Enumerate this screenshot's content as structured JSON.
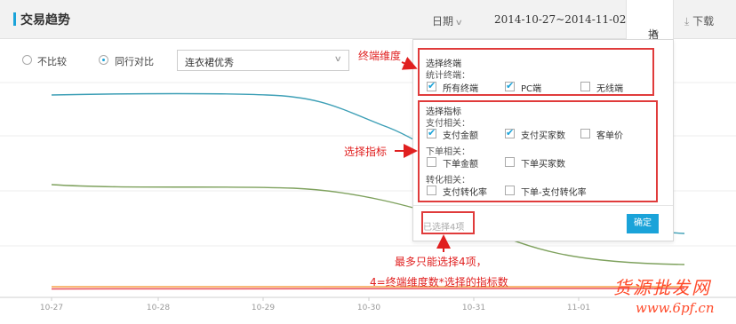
{
  "header": {
    "title": "交易趋势",
    "date_label": "日期",
    "date_range": "2014-10-27~2014-11-02",
    "indicator_label": "指标",
    "download_label": "下载"
  },
  "compare": {
    "no_compare": "不比较",
    "peer_compare": "同行对比",
    "select_value": "连衣裙优秀"
  },
  "chart_data": {
    "type": "line",
    "categories": [
      "10-27",
      "10-28",
      "10-29",
      "10-30",
      "10-31",
      "11-01"
    ],
    "series": [
      {
        "color": "#3d9fb6"
      },
      {
        "color": "#7ea15d"
      },
      {
        "color": "#f5a34a"
      },
      {
        "color": "#e84e5a"
      }
    ]
  },
  "popup": {
    "terminal_title": "选择终端",
    "terminal_sub": "统计终端：",
    "terminals": [
      {
        "label": "所有终端",
        "checked": true
      },
      {
        "label": "PC端",
        "checked": true
      },
      {
        "label": "无线端",
        "checked": false
      }
    ],
    "metric_title": "选择指标",
    "pay_sub": "支付相关：",
    "pay": [
      {
        "label": "支付金额",
        "checked": true
      },
      {
        "label": "支付买家数",
        "checked": true
      },
      {
        "label": "客单价",
        "checked": false
      }
    ],
    "order_sub": "下单相关：",
    "order": [
      {
        "label": "下单金额",
        "checked": false
      },
      {
        "label": "下单买家数",
        "checked": false
      }
    ],
    "conv_sub": "转化相关：",
    "conv": [
      {
        "label": "支付转化率",
        "checked": false
      },
      {
        "label": "下单-支付转化率",
        "checked": false
      }
    ],
    "selected_count": "已选择4项",
    "confirm": "确定"
  },
  "annotations": {
    "terminal_dim": "终端维度",
    "select_metric": "选择指标",
    "note_line1": "最多只能选择4项，",
    "note_line2": "4=终端维度数*选择的指标数"
  },
  "watermark": {
    "line1": "货源批发网",
    "line2": "www.6pf.cn"
  },
  "colors": {
    "accent": "#1aa3d9",
    "annotation_red": "#e03b3b"
  }
}
